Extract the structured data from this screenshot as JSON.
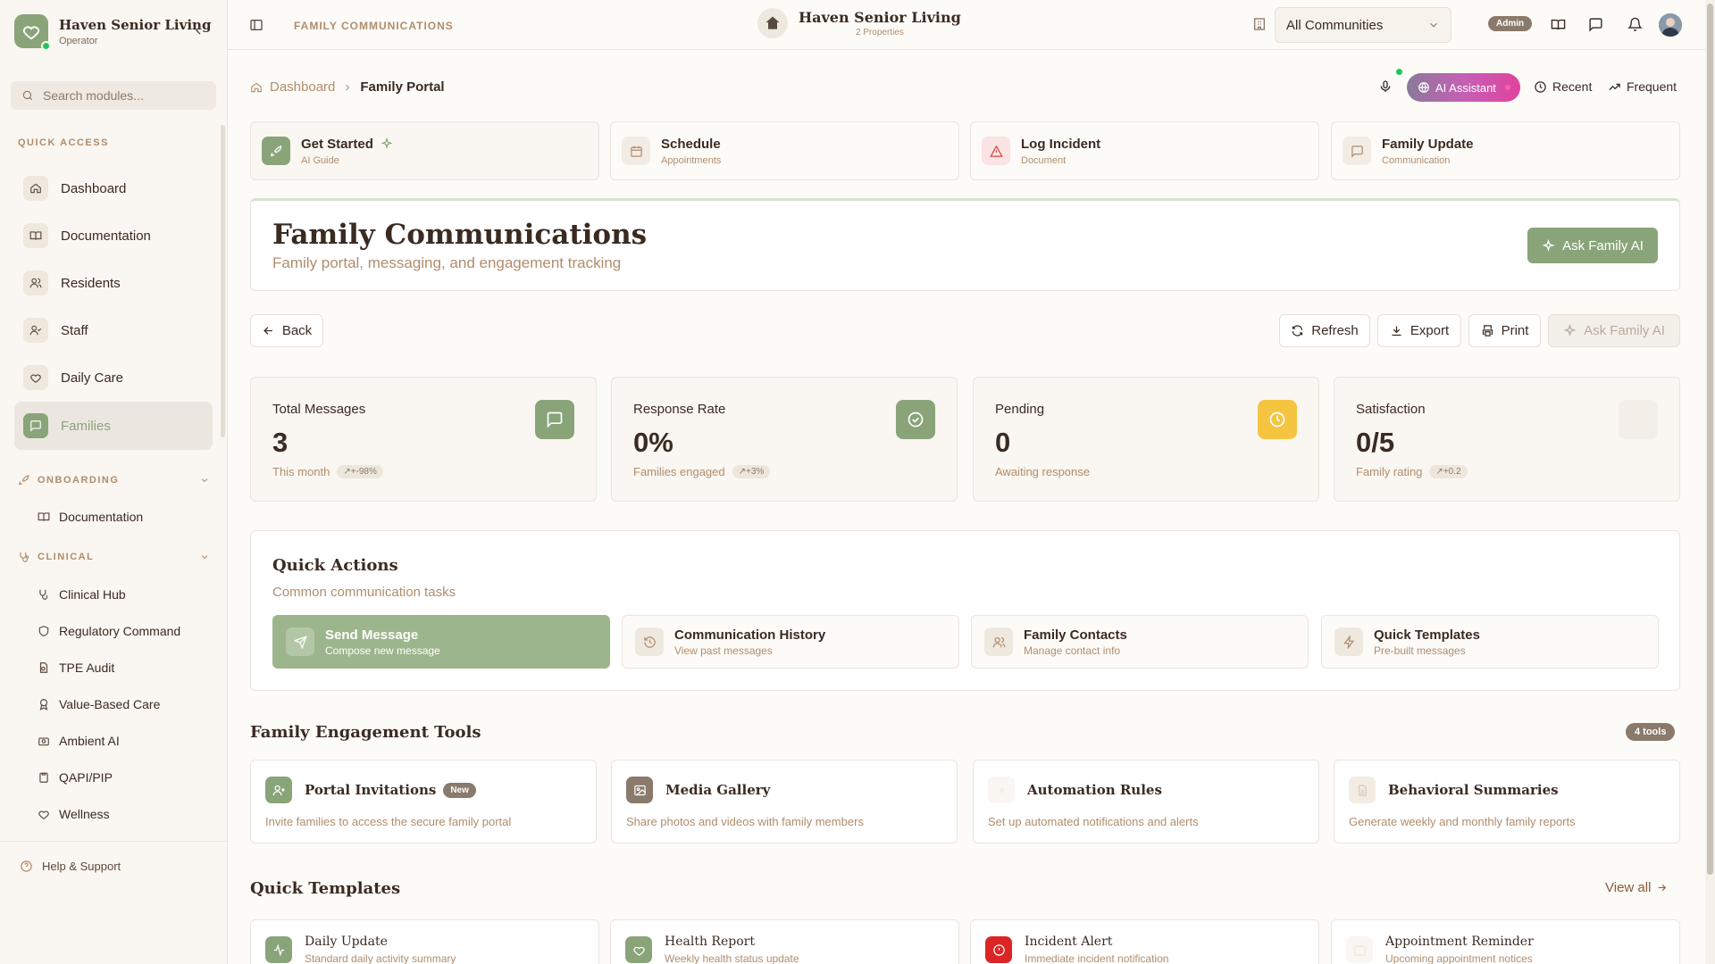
{
  "sidebar": {
    "brand_name": "Haven Senior Living",
    "brand_role": "Operator",
    "search_placeholder": "Search modules...",
    "quick_access_label": "QUICK ACCESS",
    "quick_items": [
      {
        "label": "Dashboard",
        "icon": "home-icon"
      },
      {
        "label": "Documentation",
        "icon": "book-icon"
      },
      {
        "label": "Residents",
        "icon": "users-icon"
      },
      {
        "label": "Staff",
        "icon": "user-check-icon"
      },
      {
        "label": "Daily Care",
        "icon": "heart-icon"
      },
      {
        "label": "Families",
        "icon": "message-icon",
        "active": true
      }
    ],
    "onboarding_label": "ONBOARDING",
    "onboarding_items": [
      {
        "label": "Documentation",
        "icon": "book-icon"
      }
    ],
    "clinical_label": "CLINICAL",
    "clinical_items": [
      {
        "label": "Clinical Hub",
        "icon": "stethoscope-icon"
      },
      {
        "label": "Regulatory Command",
        "icon": "shield-icon"
      },
      {
        "label": "TPE Audit",
        "icon": "file-search-icon"
      },
      {
        "label": "Value-Based Care",
        "icon": "award-icon"
      },
      {
        "label": "Ambient AI",
        "icon": "camera-icon"
      },
      {
        "label": "QAPI/PIP",
        "icon": "clipboard-icon"
      },
      {
        "label": "Wellness",
        "icon": "heart-pulse-icon"
      }
    ],
    "help_label": "Help & Support"
  },
  "topbar": {
    "page_title": "FAMILY COMMUNICATIONS",
    "center_name": "Haven Senior Living",
    "center_sub": "2 Properties",
    "community_select": "All Communities",
    "admin_badge": "Admin"
  },
  "breadcrumb": {
    "home": "Dashboard",
    "current": "Family Portal"
  },
  "header_actions": {
    "ai_assistant": "AI Assistant",
    "recent": "Recent",
    "frequent": "Frequent"
  },
  "quick_cards": [
    {
      "title": "Get Started",
      "sub": "AI Guide",
      "icon": "rocket-icon"
    },
    {
      "title": "Schedule",
      "sub": "Appointments",
      "icon": "calendar-icon"
    },
    {
      "title": "Log Incident",
      "sub": "Document",
      "icon": "alert-triangle-icon"
    },
    {
      "title": "Family Update",
      "sub": "Communication",
      "icon": "message-icon"
    }
  ],
  "hero": {
    "title": "Family Communications",
    "subtitle": "Family portal, messaging, and engagement tracking",
    "ask_button": "Ask Family AI"
  },
  "toolbar": {
    "back": "Back",
    "refresh": "Refresh",
    "export": "Export",
    "print": "Print",
    "ask": "Ask Family AI"
  },
  "stats": [
    {
      "label": "Total Messages",
      "value": "3",
      "sub": "This month",
      "trend": "+-98%",
      "color": "#8aa47a"
    },
    {
      "label": "Response Rate",
      "value": "0%",
      "sub": "Families engaged",
      "trend": "+3%",
      "color": "#8aa47a"
    },
    {
      "label": "Pending",
      "value": "0",
      "sub": "Awaiting response",
      "trend": "",
      "color": "#f5c542"
    },
    {
      "label": "Satisfaction",
      "value": "0/5",
      "sub": "Family rating",
      "trend": "+0.2",
      "color": "#f3eee8"
    }
  ],
  "quick_actions": {
    "title": "Quick Actions",
    "subtitle": "Common communication tasks",
    "items": [
      {
        "title": "Send Message",
        "sub": "Compose new message",
        "icon": "send-icon"
      },
      {
        "title": "Communication History",
        "sub": "View past messages",
        "icon": "history-icon"
      },
      {
        "title": "Family Contacts",
        "sub": "Manage contact info",
        "icon": "users-icon"
      },
      {
        "title": "Quick Templates",
        "sub": "Pre-built messages",
        "icon": "zap-icon"
      }
    ]
  },
  "tools": {
    "title": "Family Engagement Tools",
    "badge": "4 tools",
    "items": [
      {
        "title": "Portal Invitations",
        "badge": "New",
        "desc": "Invite families to access the secure family portal",
        "icon": "user-plus-icon"
      },
      {
        "title": "Media Gallery",
        "badge": "",
        "desc": "Share photos and videos with family members",
        "icon": "image-icon"
      },
      {
        "title": "Automation Rules",
        "badge": "",
        "desc": "Set up automated notifications and alerts",
        "icon": "settings-icon"
      },
      {
        "title": "Behavioral Summaries",
        "badge": "",
        "desc": "Generate weekly and monthly family reports",
        "icon": "file-text-icon"
      }
    ]
  },
  "templates": {
    "title": "Quick Templates",
    "view_all": "View all",
    "items": [
      {
        "title": "Daily Update",
        "sub": "Standard daily activity summary",
        "icon": "activity-icon"
      },
      {
        "title": "Health Report",
        "sub": "Weekly health status update",
        "icon": "heart-icon"
      },
      {
        "title": "Incident Alert",
        "sub": "Immediate incident notification",
        "icon": "alert-circle-icon"
      },
      {
        "title": "Appointment Reminder",
        "sub": "Upcoming appointment notices",
        "icon": "calendar-icon"
      }
    ]
  }
}
